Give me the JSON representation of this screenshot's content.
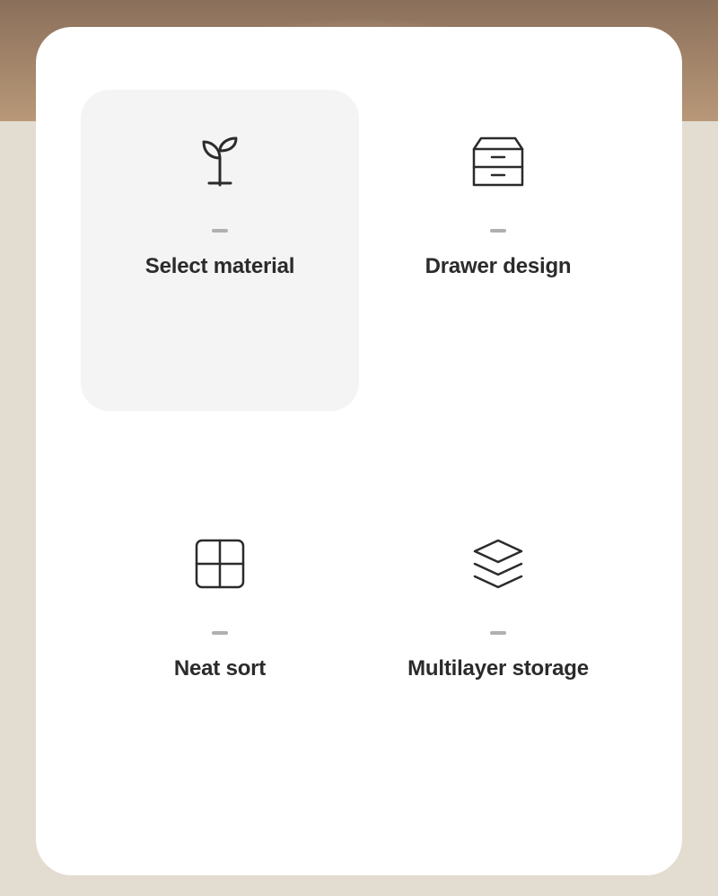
{
  "features": [
    {
      "label": "Select material",
      "selected": true
    },
    {
      "label": "Drawer design",
      "selected": false
    },
    {
      "label": "Neat sort",
      "selected": false
    },
    {
      "label": "Multilayer storage",
      "selected": false
    }
  ]
}
